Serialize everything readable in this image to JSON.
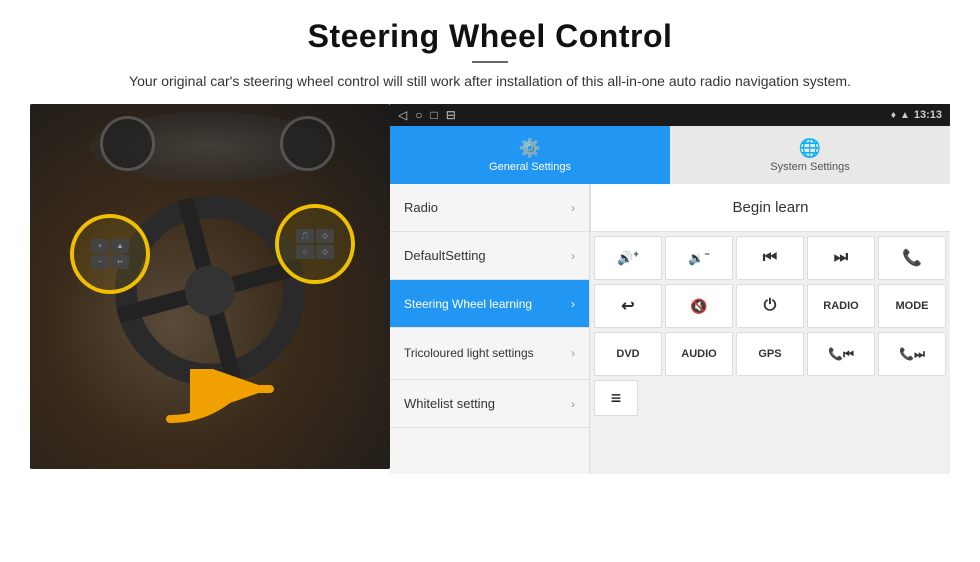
{
  "header": {
    "title": "Steering Wheel Control",
    "description": "Your original car's steering wheel control will still work after installation of this all-in-one auto radio navigation system."
  },
  "status_bar": {
    "time": "13:13",
    "icons": [
      "◁",
      "○",
      "□",
      "⊟"
    ]
  },
  "tabs": [
    {
      "id": "general",
      "label": "General Settings",
      "icon": "⚙",
      "active": true
    },
    {
      "id": "system",
      "label": "System Settings",
      "icon": "🌐",
      "active": false
    }
  ],
  "menu_items": [
    {
      "id": "radio",
      "label": "Radio",
      "active": false
    },
    {
      "id": "default-setting",
      "label": "DefaultSetting",
      "active": false
    },
    {
      "id": "steering-wheel",
      "label": "Steering Wheel learning",
      "active": true
    },
    {
      "id": "tricoloured",
      "label": "Tricoloured light settings",
      "active": false
    },
    {
      "id": "whitelist",
      "label": "Whitelist setting",
      "active": false
    }
  ],
  "begin_learn_label": "Begin learn",
  "control_buttons": {
    "row1": [
      {
        "id": "vol-up",
        "label": "🔊+",
        "type": "icon"
      },
      {
        "id": "vol-down",
        "label": "🔉−",
        "type": "icon"
      },
      {
        "id": "prev-track",
        "label": "⏮",
        "type": "icon"
      },
      {
        "id": "next-track",
        "label": "⏭",
        "type": "icon"
      },
      {
        "id": "phone",
        "label": "📞",
        "type": "icon"
      }
    ],
    "row2": [
      {
        "id": "call-end",
        "label": "↩",
        "type": "icon"
      },
      {
        "id": "mute",
        "label": "🔇",
        "type": "icon"
      },
      {
        "id": "power",
        "label": "⏻",
        "type": "icon"
      },
      {
        "id": "radio-btn",
        "label": "RADIO",
        "type": "text"
      },
      {
        "id": "mode-btn",
        "label": "MODE",
        "type": "text"
      }
    ],
    "row3": [
      {
        "id": "dvd",
        "label": "DVD",
        "type": "text"
      },
      {
        "id": "audio",
        "label": "AUDIO",
        "type": "text"
      },
      {
        "id": "gps",
        "label": "GPS",
        "type": "text"
      },
      {
        "id": "phone-prev",
        "label": "📞⏮",
        "type": "icon"
      },
      {
        "id": "phone-next",
        "label": "📞⏭",
        "type": "icon"
      }
    ]
  },
  "list_icon_label": "≡",
  "arrow_color": "#f0a000"
}
